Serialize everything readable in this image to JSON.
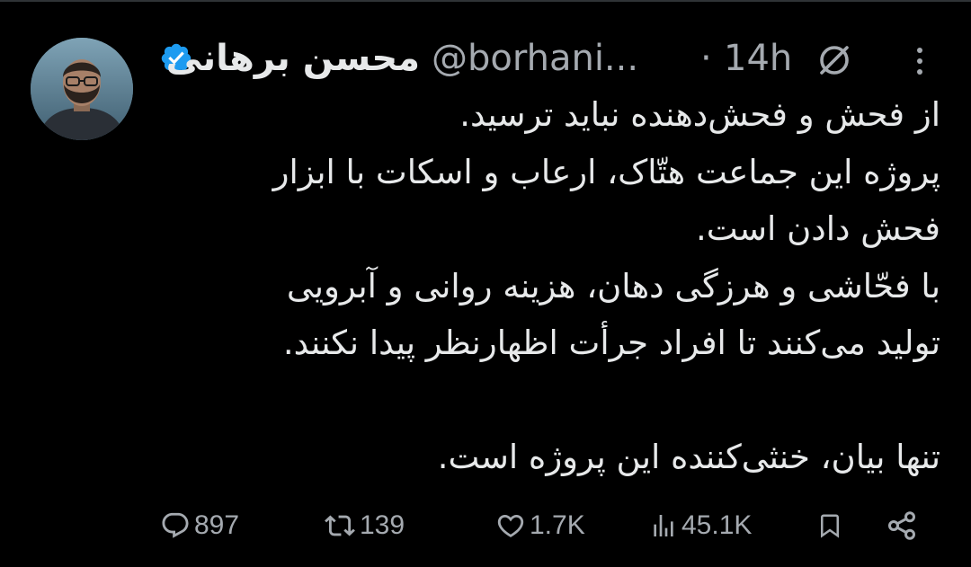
{
  "user": {
    "display_name": "محسن برهانی",
    "handle": "@borhani...",
    "verified": true,
    "time_separator": "·",
    "timestamp": "14h"
  },
  "icons": {
    "verified": "verified-badge-icon",
    "mute": "muted-icon",
    "more": "more-vertical-icon",
    "reply": "reply-icon",
    "retweet": "retweet-icon",
    "like": "like-icon",
    "views": "views-icon",
    "bookmark": "bookmark-icon",
    "share": "share-icon"
  },
  "colors": {
    "background": "#000000",
    "text": "#e7e9ea",
    "secondary_text": "#a5aab0",
    "verified_blue": "#1d9bf0"
  },
  "tweet": {
    "lines": [
      "از فحش و فحش‌دهنده نباید ترسید.",
      "پروژه این جماعت هتّاک، ارعاب و اسکات با ابزار",
      "فحش دادن است.",
      "با فحّاشی و هرزگی دهان، هزینه روانی و آبرویی",
      "تولید می‌کنند تا افراد جرأت اظهارنظر پیدا نکنند.",
      "",
      "تنها بیان، خنثی‌کننده این پروژه است."
    ]
  },
  "actions": {
    "replies": "897",
    "retweets": "139",
    "likes": "1.7K",
    "views": "45.1K"
  }
}
